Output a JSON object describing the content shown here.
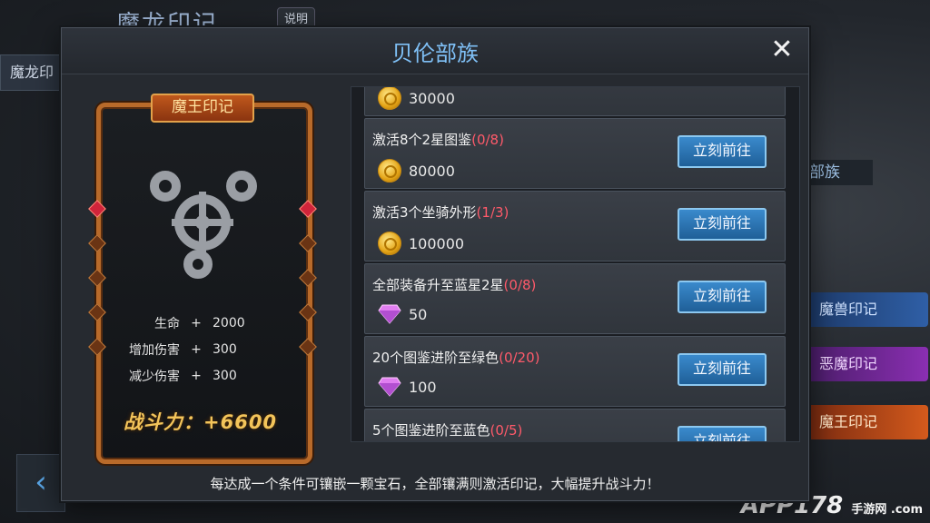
{
  "background": {
    "screen_title": "魔龙印记",
    "help_label": "说明",
    "left_tab": "魔龙印",
    "tribe_label": "部族",
    "side_tags": [
      "魔兽印记",
      "恶魔印记",
      "魔王印记"
    ],
    "watermark": "APP178",
    "watermark_sub": "手游网\n.com"
  },
  "dialog": {
    "title": "贝伦部族",
    "close_icon": "close-icon",
    "footer_tip": "每达成一个条件可镶嵌一颗宝石，全部镶满则激活印记，大幅提升战斗力！"
  },
  "card": {
    "name": "魔王印记",
    "icon": "gears-icon",
    "stats": [
      {
        "name": "生命",
        "sign": "+",
        "value": "2000"
      },
      {
        "name": "增加伤害",
        "sign": "+",
        "value": "300"
      },
      {
        "name": "减少伤害",
        "sign": "+",
        "value": "300"
      }
    ],
    "power": "战斗力：+6600"
  },
  "tasks": [
    {
      "title": "",
      "progress": "",
      "reward_type": "coin",
      "reward": "30000",
      "button": ""
    },
    {
      "title": "激活8个2星图鉴",
      "progress": "(0/8)",
      "reward_type": "coin",
      "reward": "80000",
      "button": "立刻前往"
    },
    {
      "title": "激活3个坐骑外形",
      "progress": "(1/3)",
      "reward_type": "coin",
      "reward": "100000",
      "button": "立刻前往"
    },
    {
      "title": "全部装备升至蓝星2星",
      "progress": "(0/8)",
      "reward_type": "diamond",
      "reward": "50",
      "button": "立刻前往"
    },
    {
      "title": "20个图鉴进阶至绿色",
      "progress": "(0/20)",
      "reward_type": "diamond",
      "reward": "100",
      "button": "立刻前往"
    },
    {
      "title": "5个图鉴进阶至蓝色",
      "progress": "(0/5)",
      "reward_type": "diamond",
      "reward": "",
      "button": "立刻前往"
    }
  ]
}
